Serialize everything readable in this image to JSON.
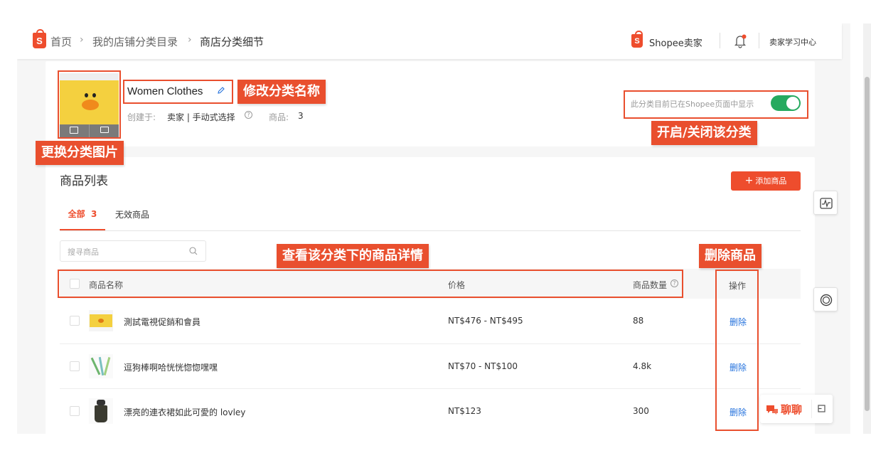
{
  "header": {
    "breadcrumb": {
      "home": "首页",
      "level2": "我的店铺分类目录",
      "current": "商店分类细节",
      "sep": "›"
    },
    "brand": "Shopee卖家",
    "learning_center": "卖家学习中心"
  },
  "category": {
    "name": "Women Clothes",
    "created_label": "创建于:",
    "created_value": "卖家 | 手动式选择",
    "products_label": "商品:",
    "products_count": "3",
    "display_status": "此分类目前已在Shopee页面中显示",
    "toggle_on": true
  },
  "annotations": {
    "rename": "修改分类名称",
    "change_image": "更换分类图片",
    "toggle": "开启/关闭该分类",
    "view_products": "查看该分类下的商品详情",
    "delete": "删除商品"
  },
  "product_list": {
    "title": "商品列表",
    "add_button": "添加商品",
    "tabs": [
      {
        "label": "全部",
        "count": "3"
      },
      {
        "label": "无效商品"
      }
    ],
    "search_placeholder": "搜寻商品",
    "columns": {
      "name": "商品名称",
      "price": "价格",
      "qty": "商品数量",
      "action": "操作"
    },
    "rows": [
      {
        "name": "測試電視促銷和會員",
        "price": "NT$476 - NT$495",
        "qty": "88",
        "action": "删除"
      },
      {
        "name": "逗狗棒啊哈恍恍惚惚嘿嘿",
        "price": "NT$70 - NT$100",
        "qty": "4.8k",
        "action": "删除"
      },
      {
        "name": "漂亮的連衣裙如此可愛的 lovley",
        "price": "NT$123",
        "qty": "300",
        "action": "删除"
      }
    ]
  },
  "chat": {
    "label": "聊聊"
  },
  "colors": {
    "brand": "#ee4d2d",
    "annotation": "#e94f2e",
    "toggle": "#26aa5f",
    "link": "#2673dd"
  }
}
